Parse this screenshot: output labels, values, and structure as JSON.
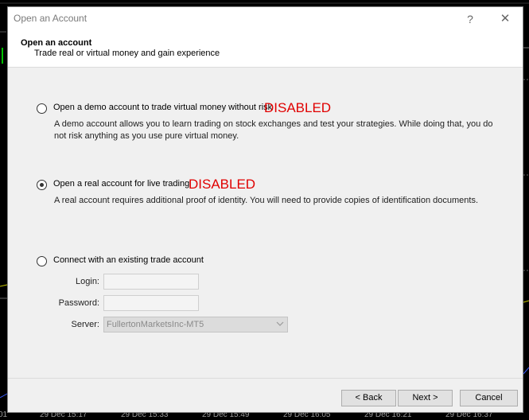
{
  "window": {
    "title": "Open an Account",
    "help_glyph": "?",
    "close_glyph": "✕"
  },
  "header": {
    "title": "Open an account",
    "subtitle": "Trade real or virtual money and gain experience"
  },
  "options": {
    "demo": {
      "label": "Open a demo account to trade virtual money without risk",
      "tag": "DISABLED",
      "description": "A demo account allows you to learn trading on stock exchanges and test your strategies. While doing that, you do not risk anything as you use pure virtual money.",
      "checked": false
    },
    "real": {
      "label": "Open a real account for live trading",
      "tag": "DISABLED",
      "description": "A real account requires additional proof of identity. You will need to provide copies of identification documents.",
      "checked": true
    },
    "existing": {
      "label": "Connect with an existing trade account",
      "checked": false,
      "login_label": "Login:",
      "login_value": "",
      "password_label": "Password:",
      "password_value": "",
      "server_label": "Server:",
      "server_value": "FullertonMarketsInc-MT5"
    }
  },
  "buttons": {
    "back": "< Back",
    "next": "Next >",
    "cancel": "Cancel"
  },
  "background_axis": {
    "ticks": [
      "01",
      "29 Dec 15:17",
      "29 Dec 15:33",
      "29 Dec 15:49",
      "29 Dec 16:05",
      "29 Dec 16:21",
      "29 Dec 16:37"
    ]
  },
  "colors": {
    "disabled_tag": "#e00000",
    "dialog_bg": "#f0f0f0",
    "chart_bg": "#000000"
  }
}
